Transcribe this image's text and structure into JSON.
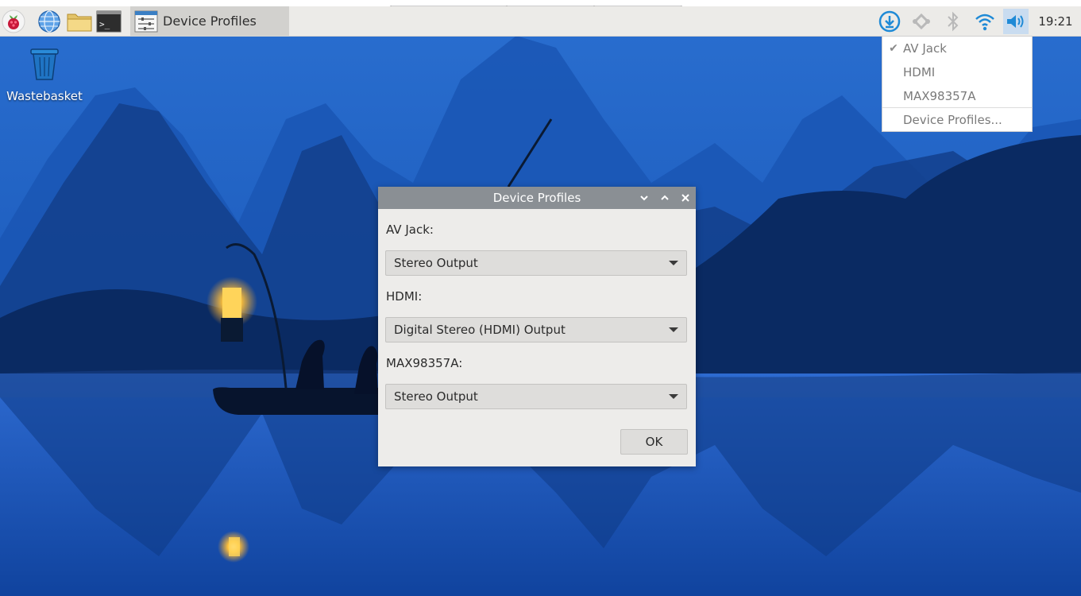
{
  "taskbar": {
    "launchers": [
      {
        "name": "raspberry-menu",
        "icon": "raspberry-pi-icon"
      },
      {
        "name": "web-browser",
        "icon": "globe-icon"
      },
      {
        "name": "file-manager",
        "icon": "folder-icon"
      },
      {
        "name": "terminal",
        "icon": "terminal-icon"
      }
    ],
    "active_task": {
      "label": "Device Profiles",
      "icon": "settings-window-icon"
    },
    "tray": [
      {
        "name": "updater",
        "icon": "download-update-icon"
      },
      {
        "name": "vnc",
        "icon": "vnc-icon"
      },
      {
        "name": "bluetooth",
        "icon": "bluetooth-icon"
      },
      {
        "name": "wifi",
        "icon": "wifi-icon"
      },
      {
        "name": "volume",
        "icon": "volume-icon"
      }
    ],
    "clock": "19:21"
  },
  "desktop": {
    "icons": [
      {
        "label": "Wastebasket",
        "icon": "wastebasket-icon"
      }
    ]
  },
  "audio_menu": {
    "items": [
      {
        "label": "AV Jack",
        "checked": true
      },
      {
        "label": "HDMI",
        "checked": false
      },
      {
        "label": "MAX98357A",
        "checked": false
      }
    ],
    "footer": "Device Profiles..."
  },
  "dialog": {
    "title": "Device Profiles",
    "fields": [
      {
        "label": "AV Jack:",
        "value": "Stereo Output"
      },
      {
        "label": "HDMI:",
        "value": "Digital Stereo (HDMI) Output"
      },
      {
        "label": "MAX98357A:",
        "value": "Stereo Output"
      }
    ],
    "ok_label": "OK"
  },
  "colors": {
    "accent": "#1f8ad6",
    "titlebar": "#8a8f94",
    "taskbar": "#ecebe8"
  }
}
